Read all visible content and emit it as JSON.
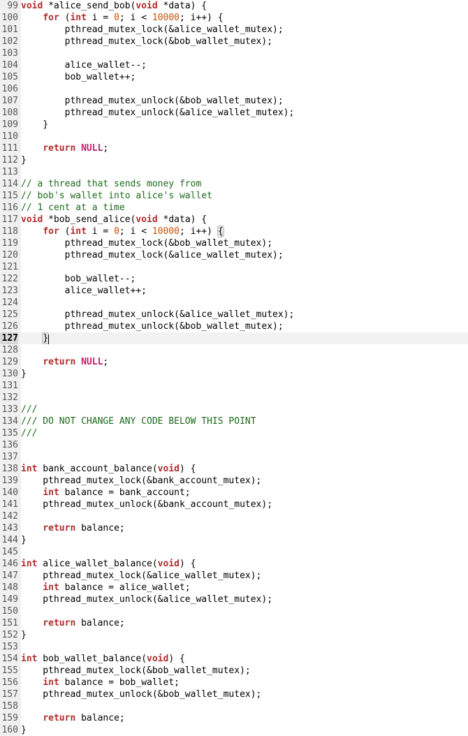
{
  "editor": {
    "first_line": 99,
    "current_line": 127,
    "lines": [
      {
        "n": 99,
        "seg": [
          [
            "kw",
            "void"
          ],
          [
            "",
            " *alice_send_bob("
          ],
          [
            "kw",
            "void"
          ],
          [
            "",
            " *data) {"
          ]
        ]
      },
      {
        "n": 100,
        "seg": [
          [
            "",
            "    "
          ],
          [
            "kw",
            "for"
          ],
          [
            "",
            " ("
          ],
          [
            "kw",
            "int"
          ],
          [
            "",
            " i = "
          ],
          [
            "num",
            "0"
          ],
          [
            "",
            "; i < "
          ],
          [
            "num",
            "10000"
          ],
          [
            "",
            "; i++) {"
          ]
        ]
      },
      {
        "n": 101,
        "seg": [
          [
            "",
            "        pthread_mutex_lock(&alice_wallet_mutex);"
          ]
        ]
      },
      {
        "n": 102,
        "seg": [
          [
            "",
            "        pthread_mutex_lock(&bob_wallet_mutex);"
          ]
        ]
      },
      {
        "n": 103,
        "seg": [
          [
            "",
            ""
          ]
        ]
      },
      {
        "n": 104,
        "seg": [
          [
            "",
            "        alice_wallet--;"
          ]
        ]
      },
      {
        "n": 105,
        "seg": [
          [
            "",
            "        bob_wallet++;"
          ]
        ]
      },
      {
        "n": 106,
        "seg": [
          [
            "",
            ""
          ]
        ]
      },
      {
        "n": 107,
        "seg": [
          [
            "",
            "        pthread_mutex_unlock(&bob_wallet_mutex);"
          ]
        ]
      },
      {
        "n": 108,
        "seg": [
          [
            "",
            "        pthread_mutex_unlock(&alice_wallet_mutex);"
          ]
        ]
      },
      {
        "n": 109,
        "seg": [
          [
            "",
            "    }"
          ]
        ]
      },
      {
        "n": 110,
        "seg": [
          [
            "",
            ""
          ]
        ]
      },
      {
        "n": 111,
        "seg": [
          [
            "",
            "    "
          ],
          [
            "kw",
            "return"
          ],
          [
            "",
            " "
          ],
          [
            "cst",
            "NULL"
          ],
          [
            "",
            ";"
          ]
        ]
      },
      {
        "n": 112,
        "seg": [
          [
            "",
            "}"
          ]
        ]
      },
      {
        "n": 113,
        "seg": [
          [
            "",
            ""
          ]
        ]
      },
      {
        "n": 114,
        "seg": [
          [
            "cmt",
            "// a thread that sends money from"
          ]
        ]
      },
      {
        "n": 115,
        "seg": [
          [
            "cmt",
            "// bob's wallet into alice's wallet"
          ]
        ]
      },
      {
        "n": 116,
        "seg": [
          [
            "cmt",
            "// 1 cent at a time"
          ]
        ]
      },
      {
        "n": 117,
        "seg": [
          [
            "kw",
            "void"
          ],
          [
            "",
            " *bob_send_alice("
          ],
          [
            "kw",
            "void"
          ],
          [
            "",
            " *data) {"
          ]
        ]
      },
      {
        "n": 118,
        "seg": [
          [
            "",
            "    "
          ],
          [
            "kw",
            "for"
          ],
          [
            "",
            " ("
          ],
          [
            "kw",
            "int"
          ],
          [
            "",
            " i = "
          ],
          [
            "num",
            "0"
          ],
          [
            "",
            "; i < "
          ],
          [
            "num",
            "10000"
          ],
          [
            "",
            "; i++) "
          ],
          [
            "bracehl",
            "{"
          ]
        ]
      },
      {
        "n": 119,
        "seg": [
          [
            "",
            "        pthread_mutex_lock(&bob_wallet_mutex);"
          ]
        ]
      },
      {
        "n": 120,
        "seg": [
          [
            "",
            "        pthread_mutex_lock(&alice_wallet_mutex);"
          ]
        ]
      },
      {
        "n": 121,
        "seg": [
          [
            "",
            ""
          ]
        ]
      },
      {
        "n": 122,
        "seg": [
          [
            "",
            "        bob_wallet--;"
          ]
        ]
      },
      {
        "n": 123,
        "seg": [
          [
            "",
            "        alice_wallet++;"
          ]
        ]
      },
      {
        "n": 124,
        "seg": [
          [
            "",
            ""
          ]
        ]
      },
      {
        "n": 125,
        "seg": [
          [
            "",
            "        pthread_mutex_unlock(&alice_wallet_mutex);"
          ]
        ]
      },
      {
        "n": 126,
        "seg": [
          [
            "",
            "        pthread_mutex_unlock(&bob_wallet_mutex);"
          ]
        ]
      },
      {
        "n": 127,
        "seg": [
          [
            "",
            "    "
          ],
          [
            "bracehl",
            "}"
          ],
          [
            "cursor",
            ""
          ]
        ]
      },
      {
        "n": 128,
        "seg": [
          [
            "",
            ""
          ]
        ]
      },
      {
        "n": 129,
        "seg": [
          [
            "",
            "    "
          ],
          [
            "kw",
            "return"
          ],
          [
            "",
            " "
          ],
          [
            "cst",
            "NULL"
          ],
          [
            "",
            ";"
          ]
        ]
      },
      {
        "n": 130,
        "seg": [
          [
            "",
            "}"
          ]
        ]
      },
      {
        "n": 131,
        "seg": [
          [
            "",
            ""
          ]
        ]
      },
      {
        "n": 132,
        "seg": [
          [
            "",
            ""
          ]
        ]
      },
      {
        "n": 133,
        "seg": [
          [
            "cmt",
            "///"
          ]
        ]
      },
      {
        "n": 134,
        "seg": [
          [
            "cmt",
            "/// DO NOT CHANGE ANY CODE BELOW THIS POINT"
          ]
        ]
      },
      {
        "n": 135,
        "seg": [
          [
            "cmt",
            "///"
          ]
        ]
      },
      {
        "n": 136,
        "seg": [
          [
            "",
            ""
          ]
        ]
      },
      {
        "n": 137,
        "seg": [
          [
            "",
            ""
          ]
        ]
      },
      {
        "n": 138,
        "seg": [
          [
            "kw",
            "int"
          ],
          [
            "",
            " bank_account_balance("
          ],
          [
            "kw",
            "void"
          ],
          [
            "",
            ") {"
          ]
        ]
      },
      {
        "n": 139,
        "seg": [
          [
            "",
            "    pthread_mutex_lock(&bank_account_mutex);"
          ]
        ]
      },
      {
        "n": 140,
        "seg": [
          [
            "",
            "    "
          ],
          [
            "kw",
            "int"
          ],
          [
            "",
            " balance = bank_account;"
          ]
        ]
      },
      {
        "n": 141,
        "seg": [
          [
            "",
            "    pthread_mutex_unlock(&bank_account_mutex);"
          ]
        ]
      },
      {
        "n": 142,
        "seg": [
          [
            "",
            ""
          ]
        ]
      },
      {
        "n": 143,
        "seg": [
          [
            "",
            "    "
          ],
          [
            "kw",
            "return"
          ],
          [
            "",
            " balance;"
          ]
        ]
      },
      {
        "n": 144,
        "seg": [
          [
            "",
            "}"
          ]
        ]
      },
      {
        "n": 145,
        "seg": [
          [
            "",
            ""
          ]
        ]
      },
      {
        "n": 146,
        "seg": [
          [
            "kw",
            "int"
          ],
          [
            "",
            " alice_wallet_balance("
          ],
          [
            "kw",
            "void"
          ],
          [
            "",
            ") {"
          ]
        ]
      },
      {
        "n": 147,
        "seg": [
          [
            "",
            "    pthread_mutex_lock(&alice_wallet_mutex);"
          ]
        ]
      },
      {
        "n": 148,
        "seg": [
          [
            "",
            "    "
          ],
          [
            "kw",
            "int"
          ],
          [
            "",
            " balance = alice_wallet;"
          ]
        ]
      },
      {
        "n": 149,
        "seg": [
          [
            "",
            "    pthread_mutex_unlock(&alice_wallet_mutex);"
          ]
        ]
      },
      {
        "n": 150,
        "seg": [
          [
            "",
            ""
          ]
        ]
      },
      {
        "n": 151,
        "seg": [
          [
            "",
            "    "
          ],
          [
            "kw",
            "return"
          ],
          [
            "",
            " balance;"
          ]
        ]
      },
      {
        "n": 152,
        "seg": [
          [
            "",
            "}"
          ]
        ]
      },
      {
        "n": 153,
        "seg": [
          [
            "",
            ""
          ]
        ]
      },
      {
        "n": 154,
        "seg": [
          [
            "kw",
            "int"
          ],
          [
            "",
            " bob_wallet_balance("
          ],
          [
            "kw",
            "void"
          ],
          [
            "",
            ") {"
          ]
        ]
      },
      {
        "n": 155,
        "seg": [
          [
            "",
            "    pthread_mutex_lock(&bob_wallet_mutex);"
          ]
        ]
      },
      {
        "n": 156,
        "seg": [
          [
            "",
            "    "
          ],
          [
            "kw",
            "int"
          ],
          [
            "",
            " balance = bob_wallet;"
          ]
        ]
      },
      {
        "n": 157,
        "seg": [
          [
            "",
            "    pthread_mutex_unlock(&bob_wallet_mutex);"
          ]
        ]
      },
      {
        "n": 158,
        "seg": [
          [
            "",
            ""
          ]
        ]
      },
      {
        "n": 159,
        "seg": [
          [
            "",
            "    "
          ],
          [
            "kw",
            "return"
          ],
          [
            "",
            " balance;"
          ]
        ]
      },
      {
        "n": 160,
        "seg": [
          [
            "",
            "}"
          ]
        ]
      }
    ]
  }
}
